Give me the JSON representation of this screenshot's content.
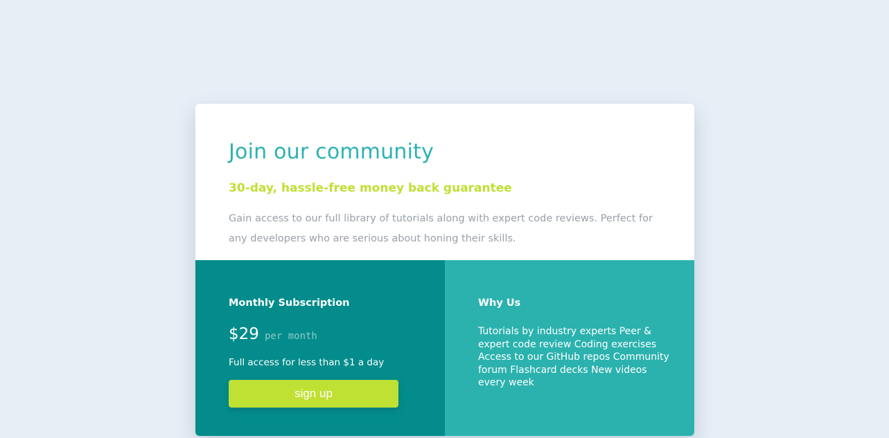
{
  "community": {
    "title": "Join our community",
    "guarantee": "30-day, hassle-free money back guarantee",
    "description": "Gain access to our full library of tutorials along with expert code reviews. Perfect for any developers who are serious about honing their skills."
  },
  "subscription": {
    "heading": "Monthly Subscription",
    "price": "$29",
    "period": "per month",
    "note": "Full access for less than $1 a day",
    "button_label": "sign up"
  },
  "why_us": {
    "heading": "Why Us",
    "text": "Tutorials by industry experts Peer & expert code review Coding exercises Access to our GitHub repos Community forum Flashcard decks New videos every week"
  },
  "colors": {
    "background": "#e6eef6",
    "title": "#2bb3b1",
    "guarantee": "#c0df34",
    "pricing_panel": "#038c8b",
    "why_panel": "#2bb2ae",
    "button": "#bfe134"
  }
}
